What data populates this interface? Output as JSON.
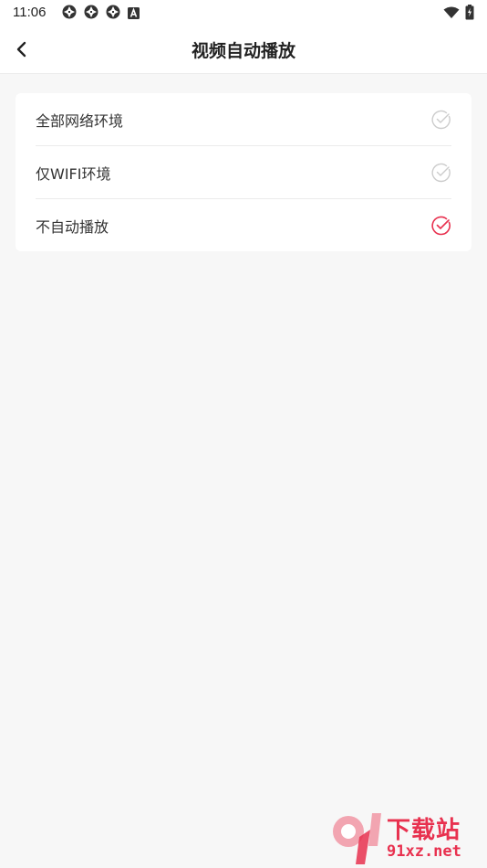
{
  "status_bar": {
    "time": "11:06",
    "left_icons": [
      "aperture-icon",
      "aperture-icon",
      "aperture-icon",
      "a-badge-icon"
    ],
    "right_icons": [
      "wifi-icon",
      "battery-charging-icon"
    ]
  },
  "header": {
    "back_icon": "chevron-left-icon",
    "title": "视频自动播放"
  },
  "options": [
    {
      "label": "全部网络环境",
      "selected": false
    },
    {
      "label": "仅WIFI环境",
      "selected": false
    },
    {
      "label": "不自动播放",
      "selected": true
    }
  ],
  "colors": {
    "accent": "#e8314f",
    "check_inactive": "#cccccc",
    "background": "#f7f7f7",
    "card": "#ffffff"
  },
  "watermark": {
    "title": "下载站",
    "url": "91xz.net"
  }
}
